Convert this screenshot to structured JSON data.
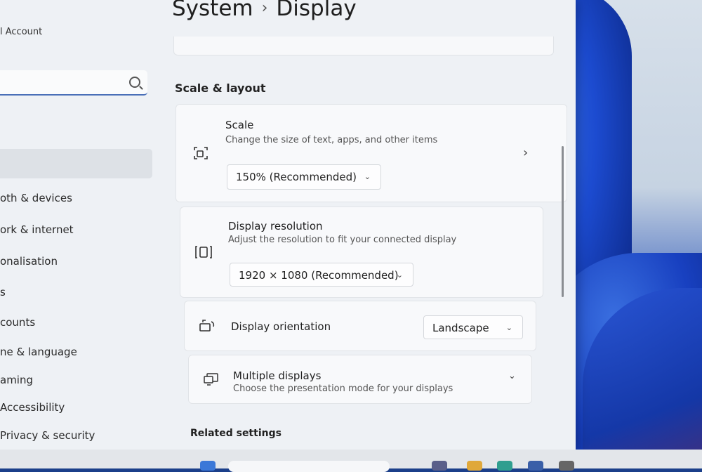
{
  "header": {
    "breadcrumb_parent": "System",
    "breadcrumb_separator": "›",
    "page_title": "Display"
  },
  "sidebar": {
    "account_label": "l Account",
    "items": [
      {
        "label": "oth & devices"
      },
      {
        "label": "ork & internet"
      },
      {
        "label": "onalisation"
      },
      {
        "label": "s"
      },
      {
        "label": "counts"
      },
      {
        "label": "ne & language"
      },
      {
        "label": "aming"
      },
      {
        "label": "Accessibility"
      },
      {
        "label": "Privacy & security"
      }
    ]
  },
  "sections": {
    "scale_layout": "Scale & layout",
    "related": "Related settings"
  },
  "scale": {
    "label": "Scale",
    "description": "Change the size of text, apps, and other items",
    "value": "150% (Recommended)"
  },
  "resolution": {
    "label": "Display resolution",
    "description": "Adjust the resolution to fit your connected display",
    "value": "1920 × 1080 (Recommended)"
  },
  "orientation": {
    "label": "Display orientation",
    "value": "Landscape"
  },
  "multiple": {
    "label": "Multiple displays",
    "description": "Choose the presentation mode for your displays"
  },
  "icons": {
    "chevron_down": "⌄",
    "chevron_right": "›"
  }
}
